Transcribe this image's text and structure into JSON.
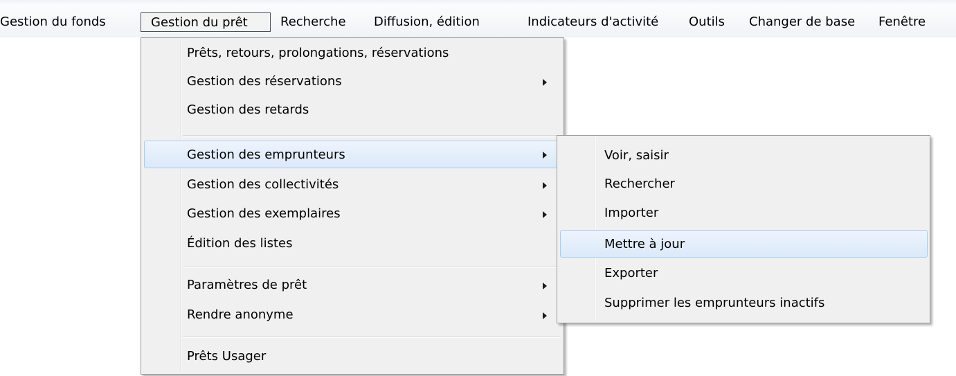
{
  "menubar": {
    "items": [
      {
        "label": "Gestion du fonds"
      },
      {
        "label": "Gestion du prêt"
      },
      {
        "label": "Recherche"
      },
      {
        "label": "Diffusion, édition"
      },
      {
        "label": "Indicateurs d'activité"
      },
      {
        "label": "Outils"
      },
      {
        "label": "Changer de base"
      },
      {
        "label": "Fenêtre"
      }
    ],
    "open_item": "Gestion du prêt"
  },
  "pret_menu": {
    "items": [
      {
        "label": "Prêts, retours, prolongations, réservations",
        "submenu": false
      },
      {
        "label": "Gestion des réservations",
        "submenu": true
      },
      {
        "label": "Gestion des retards",
        "submenu": false
      },
      {
        "label": "Gestion des emprunteurs",
        "submenu": true,
        "highlighted": true
      },
      {
        "label": "Gestion des collectivités",
        "submenu": true
      },
      {
        "label": "Gestion des exemplaires",
        "submenu": true
      },
      {
        "label": "Édition des listes",
        "submenu": false
      },
      {
        "label": "Paramètres de prêt",
        "submenu": true
      },
      {
        "label": "Rendre anonyme",
        "submenu": true
      },
      {
        "label": "Prêts Usager",
        "submenu": false
      }
    ]
  },
  "emprunteurs_submenu": {
    "items": [
      {
        "label": "Voir, saisir"
      },
      {
        "label": "Rechercher"
      },
      {
        "label": "Importer"
      },
      {
        "label": "Mettre à jour",
        "highlighted": true
      },
      {
        "label": "Exporter"
      },
      {
        "label": "Supprimer les emprunteurs inactifs"
      }
    ]
  },
  "colors": {
    "menu_background": "#f0f0f0",
    "highlight_border": "#a8cbf0",
    "highlight_fill": "#dbe9f9"
  }
}
